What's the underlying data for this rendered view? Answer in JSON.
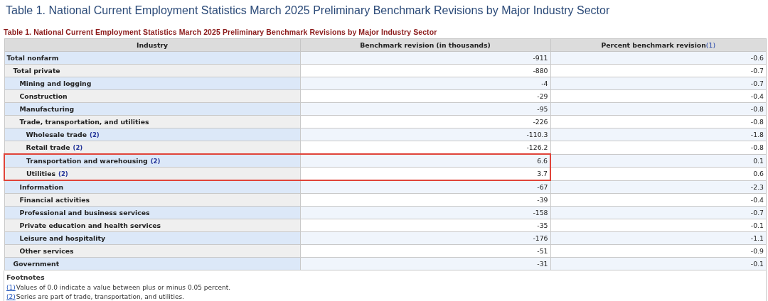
{
  "page_title": "Table 1. National Current Employment Statistics March 2025 Preliminary Benchmark Revisions by Major Industry Sector",
  "table": {
    "caption": "Table 1. National Current Employment Statistics March 2025 Preliminary Benchmark Revisions by Major Industry Sector",
    "columns": [
      {
        "label": "Industry"
      },
      {
        "label": "Benchmark revision (in thousands)"
      },
      {
        "label": "Percent benchmark revision",
        "note": "(1)"
      }
    ],
    "rows": [
      {
        "industry": "Total nonfarm",
        "revision": "-911",
        "percent": "-0.6",
        "highlighted": false,
        "children": [
          {
            "industry": "Total private",
            "revision": "-880",
            "percent": "-0.7",
            "highlighted": false,
            "children": [
              {
                "industry": "Mining and logging",
                "revision": "-4",
                "percent": "-0.7",
                "highlighted": false
              },
              {
                "industry": "Construction",
                "revision": "-29",
                "percent": "-0.4",
                "highlighted": false
              },
              {
                "industry": "Manufacturing",
                "revision": "-95",
                "percent": "-0.8",
                "highlighted": false
              },
              {
                "industry": "Trade, transportation, and utilities",
                "revision": "-226",
                "percent": "-0.8",
                "highlighted": false,
                "children": [
                  {
                    "industry": "Wholesale trade",
                    "note": "(2)",
                    "revision": "-110.3",
                    "percent": "-1.8",
                    "highlighted": false
                  },
                  {
                    "industry": "Retail trade",
                    "note": "(2)",
                    "revision": "-126.2",
                    "percent": "-0.8",
                    "highlighted": false
                  },
                  {
                    "industry": "Transportation and warehousing",
                    "note": "(2)",
                    "revision": "6.6",
                    "percent": "0.1",
                    "highlighted": true
                  },
                  {
                    "industry": "Utilities",
                    "note": "(2)",
                    "revision": "3.7",
                    "percent": "0.6",
                    "highlighted": true
                  }
                ]
              },
              {
                "industry": "Information",
                "revision": "-67",
                "percent": "-2.3",
                "highlighted": false
              },
              {
                "industry": "Financial activities",
                "revision": "-39",
                "percent": "-0.4",
                "highlighted": false
              },
              {
                "industry": "Professional and business services",
                "revision": "-158",
                "percent": "-0.7",
                "highlighted": false
              },
              {
                "industry": "Private education and health services",
                "revision": "-35",
                "percent": "-0.1",
                "highlighted": false
              },
              {
                "industry": "Leisure and hospitality",
                "revision": "-176",
                "percent": "-1.1",
                "highlighted": false
              },
              {
                "industry": "Other services",
                "revision": "-51",
                "percent": "-0.9",
                "highlighted": false
              }
            ]
          },
          {
            "industry": "Government",
            "revision": "-31",
            "percent": "-0.1",
            "highlighted": false
          }
        ]
      }
    ]
  },
  "footnotes": {
    "title": "Footnotes",
    "items": [
      {
        "mark": "(1)",
        "text": "Values of 0.0 indicate a value between plus or minus 0.05 percent."
      },
      {
        "mark": "(2)",
        "text": "Series are part of trade, transportation, and utilities."
      }
    ]
  }
}
